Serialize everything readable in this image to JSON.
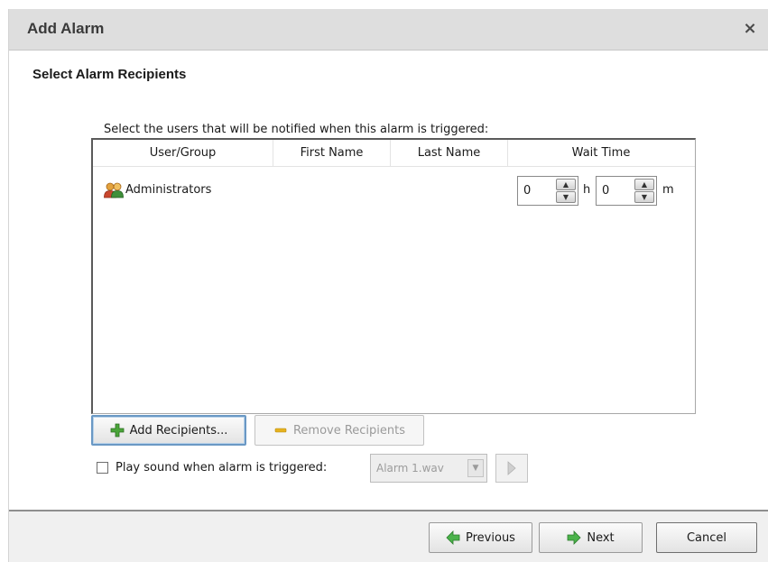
{
  "dialog": {
    "title": "Add Alarm",
    "close_glyph": "×"
  },
  "section_heading": "Select Alarm Recipients",
  "instruction": "Select the users that will be notified when this alarm is triggered:",
  "grid": {
    "columns": [
      "User/Group",
      "First Name",
      "Last Name",
      "Wait Time"
    ],
    "rows": [
      {
        "icon": "user-group-icon",
        "user_group": "Administrators",
        "first_name": "",
        "last_name": "",
        "wait_hours": "0",
        "hours_unit": "h",
        "wait_minutes": "0",
        "minutes_unit": "m"
      }
    ]
  },
  "buttons": {
    "add_recipients": "Add Recipients...",
    "remove_recipients": "Remove Recipients",
    "previous": "Previous",
    "next": "Next",
    "cancel": "Cancel"
  },
  "sound": {
    "label": "Play sound when alarm is triggered:",
    "checked": false,
    "selected_file": "Alarm 1.wav"
  },
  "colors": {
    "add_icon": "#4aa53a",
    "remove_icon": "#e6b21f",
    "nav_arrow": "#4bb34b"
  }
}
